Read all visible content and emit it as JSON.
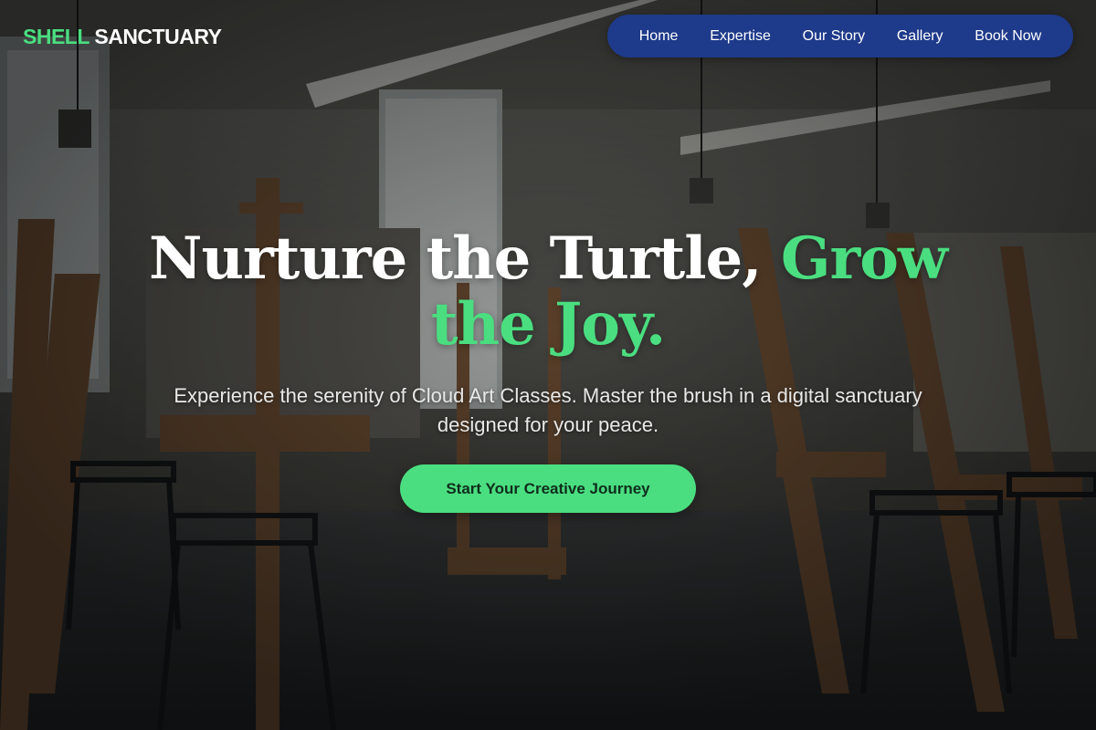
{
  "brand": {
    "name_accent": "SHELL",
    "name_rest": "SANCTUARY"
  },
  "nav": {
    "items": [
      {
        "label": "Home"
      },
      {
        "label": "Expertise"
      },
      {
        "label": "Our Story"
      },
      {
        "label": "Gallery"
      },
      {
        "label": "Book Now"
      }
    ]
  },
  "hero": {
    "headline_white": "Nurture the Turtle, ",
    "headline_accent": "Grow the Joy.",
    "subtitle": "Experience the serenity of Cloud Art Classes. Master the brush in a digital sanctuary designed for your peace.",
    "cta_label": "Start Your Creative Journey",
    "background_image": "art-studio-easels-photo"
  },
  "colors": {
    "accent_green": "#4ade80",
    "nav_background": "#1e3a8a",
    "text_white": "#ffffff"
  }
}
